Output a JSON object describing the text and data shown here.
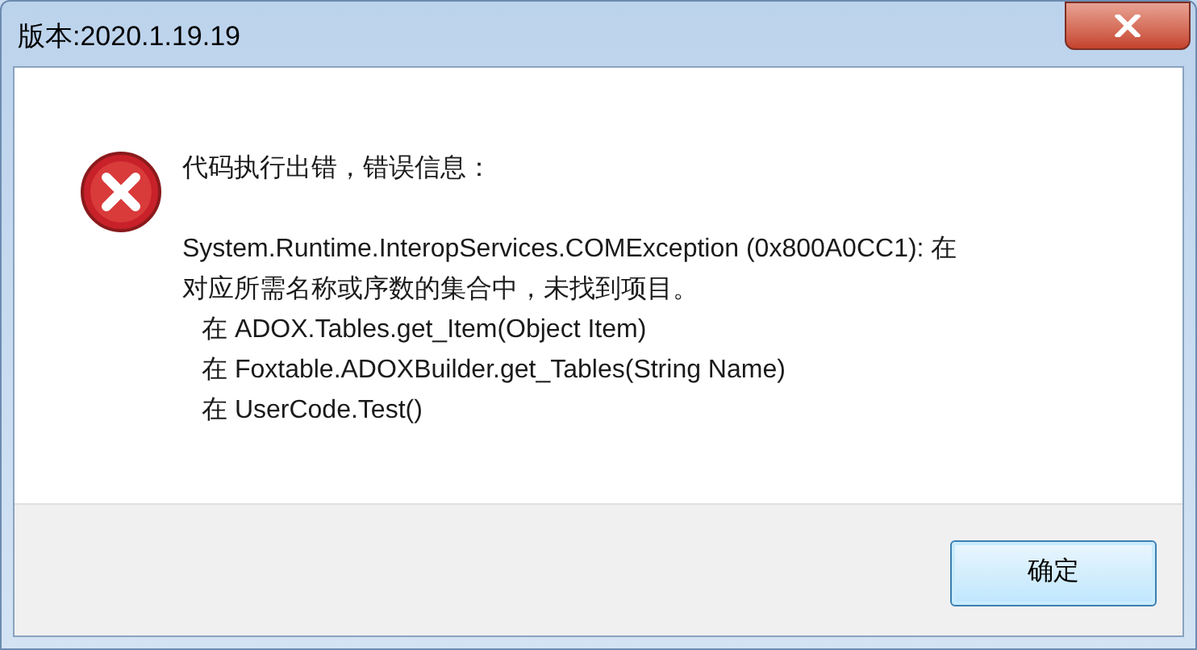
{
  "window": {
    "title": "版本:2020.1.19.19"
  },
  "message": {
    "heading": "代码执行出错，错误信息：",
    "lines": [
      {
        "kind": "text",
        "text": "System.Runtime.InteropServices.COMException (0x800A0CC1): 在"
      },
      {
        "kind": "text",
        "text": "对应所需名称或序数的集合中，未找到项目。"
      },
      {
        "kind": "trace",
        "text": "在 ADOX.Tables.get_Item(Object Item)"
      },
      {
        "kind": "trace",
        "text": "在 Foxtable.ADOXBuilder.get_Tables(String Name)"
      },
      {
        "kind": "trace",
        "text": "在 UserCode.Test()"
      }
    ]
  },
  "buttons": [
    "确定"
  ]
}
